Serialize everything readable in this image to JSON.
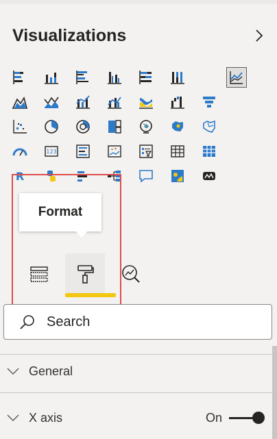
{
  "pane": {
    "title": "Visualizations",
    "collapse_icon": "chevron-right-icon"
  },
  "visuals": [
    "stacked-bar-chart",
    "stacked-column-chart",
    "clustered-bar-chart",
    "clustered-column-chart",
    "100-stacked-bar-chart",
    "100-stacked-column-chart",
    "line-chart",
    "area-chart",
    "stacked-area-chart",
    "line-and-stacked-column-chart",
    "line-and-clustered-column-chart",
    "ribbon-chart",
    "waterfall-chart",
    "funnel-chart",
    "scatter-chart",
    "pie-chart",
    "donut-chart",
    "treemap",
    "map",
    "filled-map",
    "shape-map",
    "gauge",
    "card",
    "multi-row-card",
    "kpi",
    "slicer",
    "table",
    "matrix",
    "r-script-visual",
    "python-visual",
    "key-influencers",
    "decomposition-tree",
    "qa",
    "smart-narrative",
    "paginated-report"
  ],
  "selected_visual": "line-chart",
  "tooltip": {
    "text": "Format"
  },
  "tabs": {
    "fields": "fields-icon",
    "format": "format-paint-roller-icon",
    "analytics": "analytics-magnifier-icon",
    "active": "format"
  },
  "search": {
    "placeholder": "Search",
    "value": ""
  },
  "sections": {
    "general": {
      "label": "General"
    },
    "x_axis": {
      "label": "X axis",
      "toggle_label": "On",
      "toggle_on": true
    }
  },
  "colors": {
    "accent_yellow": "#f2c811",
    "highlight_red": "#e04a4a",
    "icon_blue": "#2d7ac9",
    "icon_dark": "#252423"
  }
}
